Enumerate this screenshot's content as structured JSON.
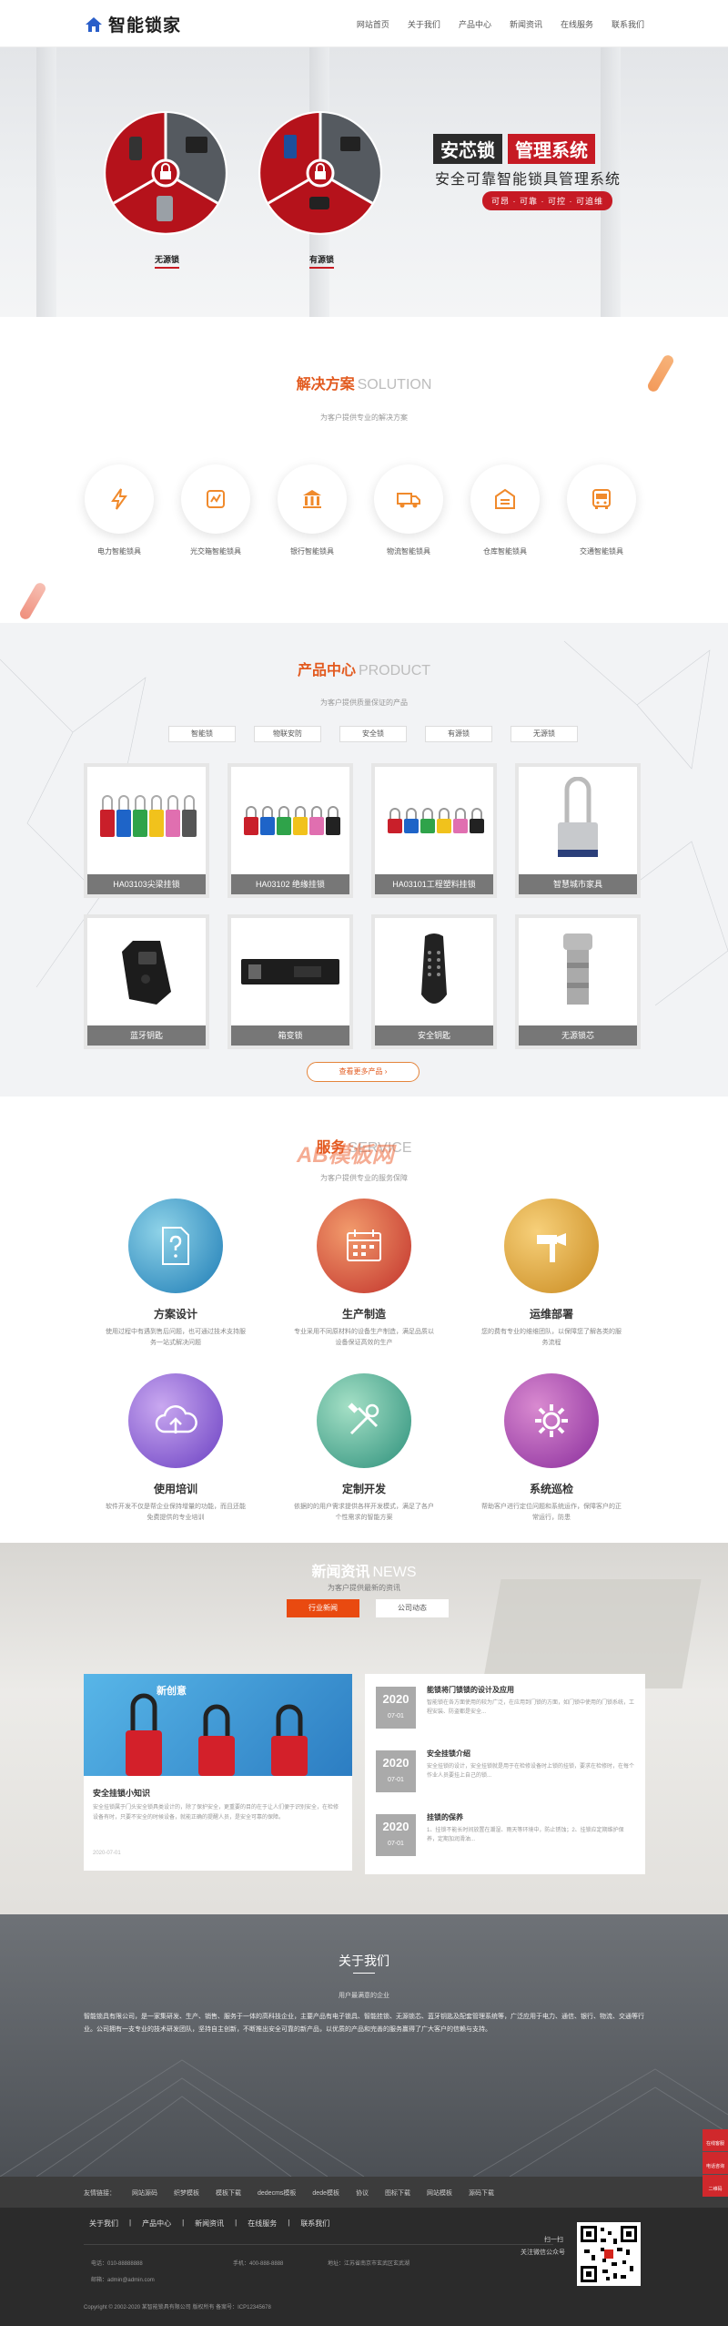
{
  "header": {
    "logo_text": "智能锁家",
    "nav": [
      "网站首页",
      "关于我们",
      "产品中心",
      "新闻资讯",
      "在线服务",
      "联系我们"
    ]
  },
  "banner": {
    "title_left": "安芯锁",
    "title_right": "管理系统",
    "subtitle": "安全可靠智能锁具管理系统",
    "tags": "可昂 · 可靠 · 可控 · 可追维",
    "circle1_tag": "无源锁",
    "circle2_tag": "有源锁"
  },
  "solution": {
    "title": "解决方案",
    "title_en": "SOLUTION",
    "subtitle": "为客户提供专业的解决方案",
    "items": [
      {
        "label": "电力智能锁具",
        "icon": "lightning-icon"
      },
      {
        "label": "光交箱智能锁具",
        "icon": "chart-box-icon"
      },
      {
        "label": "银行智能锁具",
        "icon": "bank-icon"
      },
      {
        "label": "物流智能锁具",
        "icon": "truck-icon"
      },
      {
        "label": "仓库智能锁具",
        "icon": "warehouse-icon"
      },
      {
        "label": "交通智能锁具",
        "icon": "bus-icon"
      }
    ]
  },
  "products": {
    "title": "产品中心",
    "title_en": "PRODUCT",
    "subtitle": "为客户提供质量保证的产品",
    "tabs": [
      "智能锁",
      "物联安防",
      "安全锁",
      "有源锁",
      "无源锁"
    ],
    "items": [
      {
        "name": "HA03103尖梁挂锁"
      },
      {
        "name": "HA03102 绝缘挂锁"
      },
      {
        "name": "HA03101工程塑料挂锁"
      },
      {
        "name": "智慧城市家具"
      },
      {
        "name": "蓝牙钥匙"
      },
      {
        "name": "箱变锁"
      },
      {
        "name": "安全钥匙"
      },
      {
        "name": "无源锁芯"
      }
    ],
    "more": "查看更多产品"
  },
  "service": {
    "title": "服务",
    "title_en": "SERVICE",
    "watermark": "AB模板网",
    "subtitle": "为客户提供专业的服务保障",
    "items": [
      {
        "name": "方案设计",
        "desc": "使用过程中有遇到售后问题，也可通过技术支持服务一站式解决问题"
      },
      {
        "name": "生产制造",
        "desc": "专业采用不同原材料的设备生产制造，满足品质以设备保证高效的生产"
      },
      {
        "name": "运维部署",
        "desc": "您的费有专业的维维团队，以保障您了解各类的服务流程"
      },
      {
        "name": "使用培训",
        "desc": "软件开发不仅是帮企业保持增量的功能，而且还能免费提供的专业培训"
      },
      {
        "name": "定制开发",
        "desc": "依据的的用户需求提供各样开发模式，满足了各户个性需求的智能方案"
      },
      {
        "name": "系统巡检",
        "desc": "帮助客户进行定位问题和系统运作，保障客户的正常运行，防患"
      }
    ]
  },
  "news": {
    "title": "新闻资讯",
    "title_en": "NEWS",
    "subtitle": "为客户提供最新的资讯",
    "tabs": [
      "行业新闻",
      "公司动态"
    ],
    "featured": {
      "img_text": "新创意",
      "title": "安全挂锁小知识",
      "desc": "安全挂锁属于门头安全锁具类设计的，除了保护安全，更重要的目的在于让人们便于识别安全，在检修设备有时，只要不安全的时候设备，就能正确的提醒人员，是安全可靠的保障。",
      "date": "2020-07-01"
    },
    "items": [
      {
        "year": "2020",
        "md": "07-01",
        "title": "能锁将门锁锁的设计及应用",
        "desc": "智能锁在各方面使用的较为广泛，在应用到门锁的方面，如门锁中使用的门锁系统，工程安装、防盗都是安全..."
      },
      {
        "year": "2020",
        "md": "07-01",
        "title": "安全挂锁介绍",
        "desc": "安全挂锁的设计，安全挂锁就是用于在检修设备时上锁的挂锁，要求在检修时，在每个作业人员要挂上自己的锁..."
      },
      {
        "year": "2020",
        "md": "07-01",
        "title": "挂锁的保养",
        "desc": "1、挂锁不能长时间放置在潮湿、雨天等环境中，防止锈蚀；2、挂锁应定期维护保养，定期加润滑油..."
      }
    ]
  },
  "about": {
    "title": "关于我们",
    "subtitle": "用户最满意的企业",
    "text": "智能锁具有限公司，是一家集研发、生产、销售、服务于一体的高科技企业，主要产品有电子锁具、智能挂锁、无源锁芯、蓝牙钥匙及配套管理系统等，广泛应用于电力、通信、银行、物流、交通等行业。公司拥有一支专业的技术研发团队，坚持自主创新，不断推出安全可靠的新产品，以优质的产品和完善的服务赢得了广大客户的信赖与支持。"
  },
  "footer_links": {
    "label": "友情链接：",
    "items": [
      "网站源码",
      "织梦模板",
      "模板下载",
      "dedecms模板",
      "dede模板",
      "协议",
      "图标下载",
      "网站模板",
      "源码下载"
    ]
  },
  "footer": {
    "nav": [
      "关于我们",
      "产品中心",
      "新闻资讯",
      "在线服务",
      "联系我们"
    ],
    "tel": "电话：010-88888888",
    "phone": "手机：400-888-8888",
    "email": "邮箱：admin@admin.com",
    "address": "地址：江苏省南京市玄武区玄武湖",
    "copyright": "Copyright © 2002-2020 某智能锁具有限公司 版权所有 备案号：ICP12345678",
    "scan1": "扫一扫",
    "scan2": "关注微信公众号"
  },
  "side": [
    "在线客服",
    "电话咨询",
    "二维码"
  ],
  "colors": {
    "accent": "#e25a1f",
    "brand_red": "#c61a24",
    "dark": "#2b2b2b"
  }
}
